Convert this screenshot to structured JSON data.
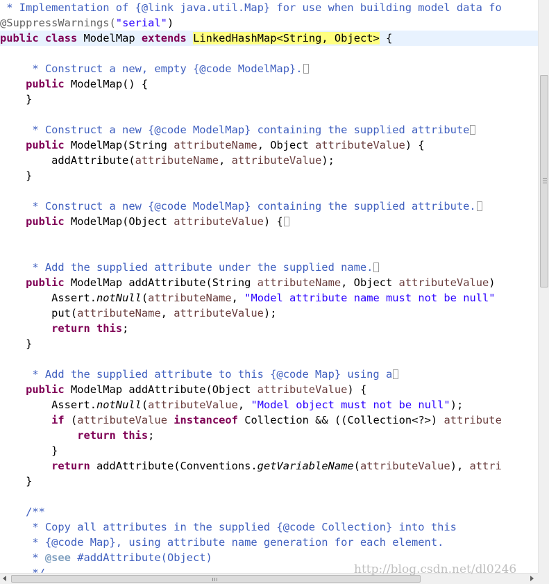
{
  "editor": {
    "language": "java",
    "lines": [
      [
        {
          "t": " * Implementation of {@link java.util.Map} for use when building model data fo",
          "c": "comment"
        }
      ],
      [
        {
          "t": "@SuppressWarnings(",
          "c": "annotation"
        },
        {
          "t": "\"serial\"",
          "c": "string"
        },
        {
          "t": ")",
          "c": "plain"
        }
      ],
      [
        {
          "t": "public",
          "c": "keyword"
        },
        {
          "t": " ",
          "c": "plain"
        },
        {
          "t": "class",
          "c": "keyword"
        },
        {
          "t": " ModelMap ",
          "c": "plain"
        },
        {
          "t": "extends",
          "c": "keyword"
        },
        {
          "t": " ",
          "c": "plain"
        },
        {
          "t": "LinkedHashMap<String, Object>",
          "c": "highlight"
        },
        {
          "t": " {",
          "c": "plain"
        }
      ],
      [],
      [
        {
          "t": "     * Construct a new, empty {@code ModelMap}.",
          "c": "comment"
        },
        {
          "fold": true
        }
      ],
      [
        {
          "t": "    ",
          "c": "plain"
        },
        {
          "t": "public",
          "c": "keyword"
        },
        {
          "t": " ModelMap() {",
          "c": "plain"
        }
      ],
      [
        {
          "t": "    }",
          "c": "plain"
        }
      ],
      [],
      [
        {
          "t": "     * Construct a new {@code ModelMap} containing the supplied attribute",
          "c": "comment"
        },
        {
          "fold": true
        }
      ],
      [
        {
          "t": "    ",
          "c": "plain"
        },
        {
          "t": "public",
          "c": "keyword"
        },
        {
          "t": " ModelMap(String ",
          "c": "plain"
        },
        {
          "t": "attributeName",
          "c": "param"
        },
        {
          "t": ", Object ",
          "c": "plain"
        },
        {
          "t": "attributeValue",
          "c": "param"
        },
        {
          "t": ") {",
          "c": "plain"
        }
      ],
      [
        {
          "t": "        addAttribute(",
          "c": "plain"
        },
        {
          "t": "attributeName",
          "c": "param"
        },
        {
          "t": ", ",
          "c": "plain"
        },
        {
          "t": "attributeValue",
          "c": "param"
        },
        {
          "t": ");",
          "c": "plain"
        }
      ],
      [
        {
          "t": "    }",
          "c": "plain"
        }
      ],
      [],
      [
        {
          "t": "     * Construct a new {@code ModelMap} containing the supplied attribute.",
          "c": "comment"
        },
        {
          "fold": true
        }
      ],
      [
        {
          "t": "    ",
          "c": "plain"
        },
        {
          "t": "public",
          "c": "keyword"
        },
        {
          "t": " ModelMap(Object ",
          "c": "plain"
        },
        {
          "t": "attributeValue",
          "c": "param"
        },
        {
          "t": ") {",
          "c": "plain"
        },
        {
          "fold": true
        }
      ],
      [],
      [],
      [
        {
          "t": "     * Add the supplied attribute under the supplied name.",
          "c": "comment"
        },
        {
          "fold": true
        }
      ],
      [
        {
          "t": "    ",
          "c": "plain"
        },
        {
          "t": "public",
          "c": "keyword"
        },
        {
          "t": " ModelMap addAttribute(String ",
          "c": "plain"
        },
        {
          "t": "attributeName",
          "c": "param"
        },
        {
          "t": ", Object ",
          "c": "plain"
        },
        {
          "t": "attributeValue",
          "c": "param"
        },
        {
          "t": ")",
          "c": "plain"
        }
      ],
      [
        {
          "t": "        Assert.",
          "c": "plain"
        },
        {
          "t": "notNull",
          "c": "static"
        },
        {
          "t": "(",
          "c": "plain"
        },
        {
          "t": "attributeName",
          "c": "param"
        },
        {
          "t": ", ",
          "c": "plain"
        },
        {
          "t": "\"Model attribute name must not be null\"",
          "c": "string"
        }
      ],
      [
        {
          "t": "        put(",
          "c": "plain"
        },
        {
          "t": "attributeName",
          "c": "param"
        },
        {
          "t": ", ",
          "c": "plain"
        },
        {
          "t": "attributeValue",
          "c": "param"
        },
        {
          "t": ");",
          "c": "plain"
        }
      ],
      [
        {
          "t": "        ",
          "c": "plain"
        },
        {
          "t": "return",
          "c": "keyword"
        },
        {
          "t": " ",
          "c": "plain"
        },
        {
          "t": "this",
          "c": "keyword"
        },
        {
          "t": ";",
          "c": "plain"
        }
      ],
      [
        {
          "t": "    }",
          "c": "plain"
        }
      ],
      [],
      [
        {
          "t": "     * Add the supplied attribute to this {@code Map} using a",
          "c": "comment"
        },
        {
          "fold": true
        }
      ],
      [
        {
          "t": "    ",
          "c": "plain"
        },
        {
          "t": "public",
          "c": "keyword"
        },
        {
          "t": " ModelMap addAttribute(Object ",
          "c": "plain"
        },
        {
          "t": "attributeValue",
          "c": "param"
        },
        {
          "t": ") {",
          "c": "plain"
        }
      ],
      [
        {
          "t": "        Assert.",
          "c": "plain"
        },
        {
          "t": "notNull",
          "c": "static"
        },
        {
          "t": "(",
          "c": "plain"
        },
        {
          "t": "attributeValue",
          "c": "param"
        },
        {
          "t": ", ",
          "c": "plain"
        },
        {
          "t": "\"Model object must not be null\"",
          "c": "string"
        },
        {
          "t": ");",
          "c": "plain"
        }
      ],
      [
        {
          "t": "        ",
          "c": "plain"
        },
        {
          "t": "if",
          "c": "keyword"
        },
        {
          "t": " (",
          "c": "plain"
        },
        {
          "t": "attributeValue",
          "c": "param"
        },
        {
          "t": " ",
          "c": "plain"
        },
        {
          "t": "instanceof",
          "c": "keyword"
        },
        {
          "t": " Collection && ((Collection<?>) ",
          "c": "plain"
        },
        {
          "t": "attribute",
          "c": "param"
        }
      ],
      [
        {
          "t": "            ",
          "c": "plain"
        },
        {
          "t": "return",
          "c": "keyword"
        },
        {
          "t": " ",
          "c": "plain"
        },
        {
          "t": "this",
          "c": "keyword"
        },
        {
          "t": ";",
          "c": "plain"
        }
      ],
      [
        {
          "t": "        }",
          "c": "plain"
        }
      ],
      [
        {
          "t": "        ",
          "c": "plain"
        },
        {
          "t": "return",
          "c": "keyword"
        },
        {
          "t": " addAttribute(Conventions.",
          "c": "plain"
        },
        {
          "t": "getVariableName",
          "c": "static"
        },
        {
          "t": "(",
          "c": "plain"
        },
        {
          "t": "attributeValue",
          "c": "param"
        },
        {
          "t": "), ",
          "c": "plain"
        },
        {
          "t": "attri",
          "c": "param"
        }
      ],
      [
        {
          "t": "    }",
          "c": "plain"
        }
      ],
      [],
      [
        {
          "t": "    /**",
          "c": "comment"
        }
      ],
      [
        {
          "t": "     * Copy all attributes in the supplied {@code Collection} into this",
          "c": "comment"
        }
      ],
      [
        {
          "t": "     * {@code Map}, using attribute name generation for each element.",
          "c": "comment"
        }
      ],
      [
        {
          "t": "     * ",
          "c": "comment"
        },
        {
          "t": "@see",
          "c": "tag"
        },
        {
          "t": " #addAttribute(Object)",
          "c": "comment"
        }
      ],
      [
        {
          "t": "     */",
          "c": "comment"
        }
      ]
    ],
    "current_line_index": 2
  },
  "watermark": {
    "text": "http://blog.csdn.net/dl0246"
  }
}
